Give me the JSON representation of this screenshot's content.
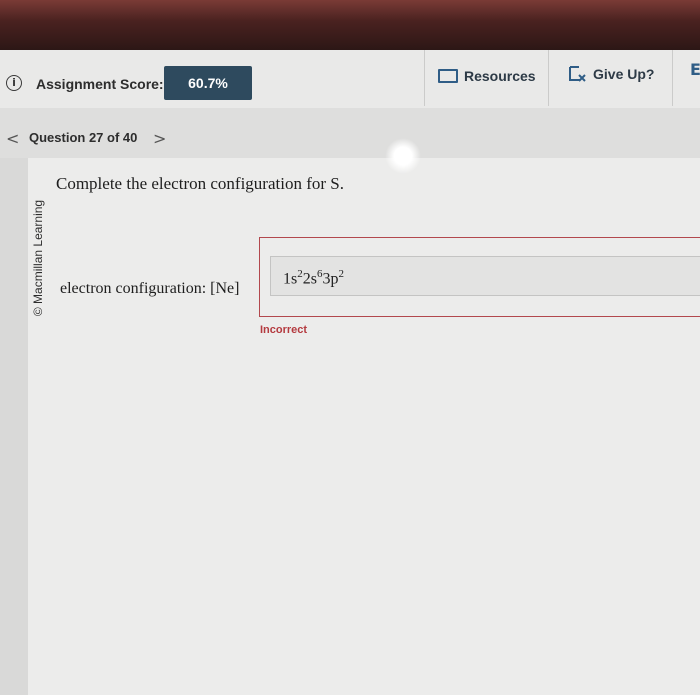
{
  "header": {
    "score_label": "Assignment Score:",
    "score_value": "60.7%",
    "resources_label": "Resources",
    "give_up_label": "Give Up?"
  },
  "navigation": {
    "question_label": "Question 27 of 40",
    "prev_glyph": "<",
    "next_glyph": ">"
  },
  "sidebar": {
    "copyright": "© Macmillan Learning"
  },
  "question": {
    "text": "Complete the electron configuration for S.",
    "prompt": "electron configuration: [Ne]",
    "answer": {
      "parts": [
        "1s",
        "2",
        "2s",
        "6",
        "3p",
        "2"
      ]
    },
    "feedback": "Incorrect"
  },
  "colors": {
    "score_badge": "#2e4a5e",
    "error": "#b43a3f",
    "link": "#2f5d86"
  }
}
